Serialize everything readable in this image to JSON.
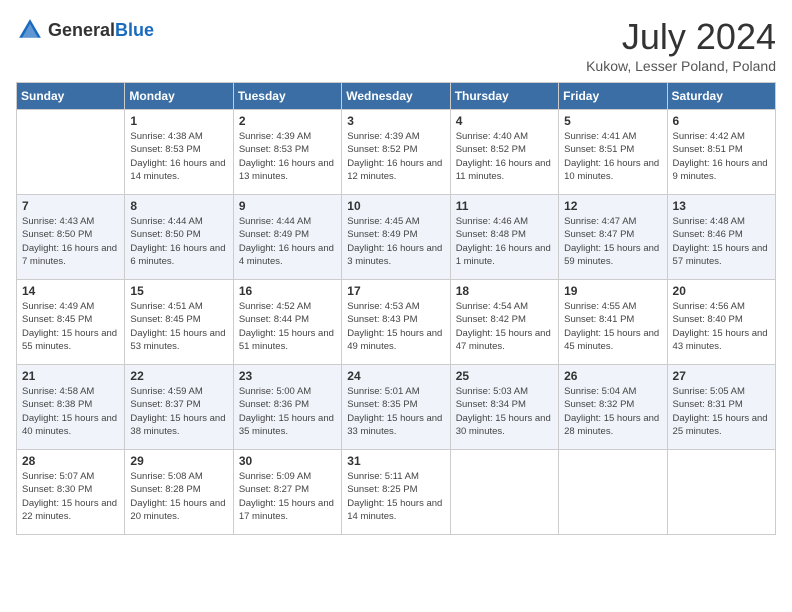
{
  "header": {
    "logo_general": "General",
    "logo_blue": "Blue",
    "month_year": "July 2024",
    "location": "Kukow, Lesser Poland, Poland"
  },
  "days_of_week": [
    "Sunday",
    "Monday",
    "Tuesday",
    "Wednesday",
    "Thursday",
    "Friday",
    "Saturday"
  ],
  "weeks": [
    [
      {
        "day": "",
        "sunrise": "",
        "sunset": "",
        "daylight": ""
      },
      {
        "day": "1",
        "sunrise": "Sunrise: 4:38 AM",
        "sunset": "Sunset: 8:53 PM",
        "daylight": "Daylight: 16 hours and 14 minutes."
      },
      {
        "day": "2",
        "sunrise": "Sunrise: 4:39 AM",
        "sunset": "Sunset: 8:53 PM",
        "daylight": "Daylight: 16 hours and 13 minutes."
      },
      {
        "day": "3",
        "sunrise": "Sunrise: 4:39 AM",
        "sunset": "Sunset: 8:52 PM",
        "daylight": "Daylight: 16 hours and 12 minutes."
      },
      {
        "day": "4",
        "sunrise": "Sunrise: 4:40 AM",
        "sunset": "Sunset: 8:52 PM",
        "daylight": "Daylight: 16 hours and 11 minutes."
      },
      {
        "day": "5",
        "sunrise": "Sunrise: 4:41 AM",
        "sunset": "Sunset: 8:51 PM",
        "daylight": "Daylight: 16 hours and 10 minutes."
      },
      {
        "day": "6",
        "sunrise": "Sunrise: 4:42 AM",
        "sunset": "Sunset: 8:51 PM",
        "daylight": "Daylight: 16 hours and 9 minutes."
      }
    ],
    [
      {
        "day": "7",
        "sunrise": "Sunrise: 4:43 AM",
        "sunset": "Sunset: 8:50 PM",
        "daylight": "Daylight: 16 hours and 7 minutes."
      },
      {
        "day": "8",
        "sunrise": "Sunrise: 4:44 AM",
        "sunset": "Sunset: 8:50 PM",
        "daylight": "Daylight: 16 hours and 6 minutes."
      },
      {
        "day": "9",
        "sunrise": "Sunrise: 4:44 AM",
        "sunset": "Sunset: 8:49 PM",
        "daylight": "Daylight: 16 hours and 4 minutes."
      },
      {
        "day": "10",
        "sunrise": "Sunrise: 4:45 AM",
        "sunset": "Sunset: 8:49 PM",
        "daylight": "Daylight: 16 hours and 3 minutes."
      },
      {
        "day": "11",
        "sunrise": "Sunrise: 4:46 AM",
        "sunset": "Sunset: 8:48 PM",
        "daylight": "Daylight: 16 hours and 1 minute."
      },
      {
        "day": "12",
        "sunrise": "Sunrise: 4:47 AM",
        "sunset": "Sunset: 8:47 PM",
        "daylight": "Daylight: 15 hours and 59 minutes."
      },
      {
        "day": "13",
        "sunrise": "Sunrise: 4:48 AM",
        "sunset": "Sunset: 8:46 PM",
        "daylight": "Daylight: 15 hours and 57 minutes."
      }
    ],
    [
      {
        "day": "14",
        "sunrise": "Sunrise: 4:49 AM",
        "sunset": "Sunset: 8:45 PM",
        "daylight": "Daylight: 15 hours and 55 minutes."
      },
      {
        "day": "15",
        "sunrise": "Sunrise: 4:51 AM",
        "sunset": "Sunset: 8:45 PM",
        "daylight": "Daylight: 15 hours and 53 minutes."
      },
      {
        "day": "16",
        "sunrise": "Sunrise: 4:52 AM",
        "sunset": "Sunset: 8:44 PM",
        "daylight": "Daylight: 15 hours and 51 minutes."
      },
      {
        "day": "17",
        "sunrise": "Sunrise: 4:53 AM",
        "sunset": "Sunset: 8:43 PM",
        "daylight": "Daylight: 15 hours and 49 minutes."
      },
      {
        "day": "18",
        "sunrise": "Sunrise: 4:54 AM",
        "sunset": "Sunset: 8:42 PM",
        "daylight": "Daylight: 15 hours and 47 minutes."
      },
      {
        "day": "19",
        "sunrise": "Sunrise: 4:55 AM",
        "sunset": "Sunset: 8:41 PM",
        "daylight": "Daylight: 15 hours and 45 minutes."
      },
      {
        "day": "20",
        "sunrise": "Sunrise: 4:56 AM",
        "sunset": "Sunset: 8:40 PM",
        "daylight": "Daylight: 15 hours and 43 minutes."
      }
    ],
    [
      {
        "day": "21",
        "sunrise": "Sunrise: 4:58 AM",
        "sunset": "Sunset: 8:38 PM",
        "daylight": "Daylight: 15 hours and 40 minutes."
      },
      {
        "day": "22",
        "sunrise": "Sunrise: 4:59 AM",
        "sunset": "Sunset: 8:37 PM",
        "daylight": "Daylight: 15 hours and 38 minutes."
      },
      {
        "day": "23",
        "sunrise": "Sunrise: 5:00 AM",
        "sunset": "Sunset: 8:36 PM",
        "daylight": "Daylight: 15 hours and 35 minutes."
      },
      {
        "day": "24",
        "sunrise": "Sunrise: 5:01 AM",
        "sunset": "Sunset: 8:35 PM",
        "daylight": "Daylight: 15 hours and 33 minutes."
      },
      {
        "day": "25",
        "sunrise": "Sunrise: 5:03 AM",
        "sunset": "Sunset: 8:34 PM",
        "daylight": "Daylight: 15 hours and 30 minutes."
      },
      {
        "day": "26",
        "sunrise": "Sunrise: 5:04 AM",
        "sunset": "Sunset: 8:32 PM",
        "daylight": "Daylight: 15 hours and 28 minutes."
      },
      {
        "day": "27",
        "sunrise": "Sunrise: 5:05 AM",
        "sunset": "Sunset: 8:31 PM",
        "daylight": "Daylight: 15 hours and 25 minutes."
      }
    ],
    [
      {
        "day": "28",
        "sunrise": "Sunrise: 5:07 AM",
        "sunset": "Sunset: 8:30 PM",
        "daylight": "Daylight: 15 hours and 22 minutes."
      },
      {
        "day": "29",
        "sunrise": "Sunrise: 5:08 AM",
        "sunset": "Sunset: 8:28 PM",
        "daylight": "Daylight: 15 hours and 20 minutes."
      },
      {
        "day": "30",
        "sunrise": "Sunrise: 5:09 AM",
        "sunset": "Sunset: 8:27 PM",
        "daylight": "Daylight: 15 hours and 17 minutes."
      },
      {
        "day": "31",
        "sunrise": "Sunrise: 5:11 AM",
        "sunset": "Sunset: 8:25 PM",
        "daylight": "Daylight: 15 hours and 14 minutes."
      },
      {
        "day": "",
        "sunrise": "",
        "sunset": "",
        "daylight": ""
      },
      {
        "day": "",
        "sunrise": "",
        "sunset": "",
        "daylight": ""
      },
      {
        "day": "",
        "sunrise": "",
        "sunset": "",
        "daylight": ""
      }
    ]
  ]
}
